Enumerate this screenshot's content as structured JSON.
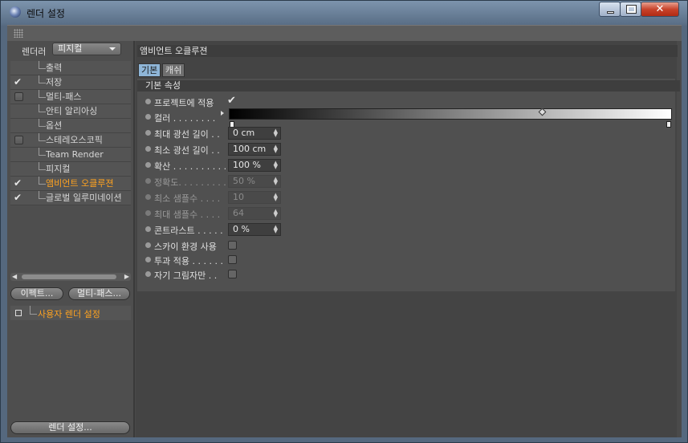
{
  "window": {
    "title": "렌더 설정"
  },
  "left": {
    "renderer_label": "렌더러",
    "renderer_value": "피지컬",
    "items": [
      {
        "label": "출력",
        "check": "none",
        "active": false
      },
      {
        "label": "저장",
        "check": "tick",
        "active": false
      },
      {
        "label": "멀티-패스",
        "check": "box",
        "active": false
      },
      {
        "label": "안티 알리아싱",
        "check": "none",
        "active": false
      },
      {
        "label": "옵션",
        "check": "none",
        "active": false
      },
      {
        "label": "스테레오스코픽",
        "check": "box",
        "active": false
      },
      {
        "label": "Team Render",
        "check": "none",
        "active": false
      },
      {
        "label": "피지컬",
        "check": "none",
        "active": false
      },
      {
        "label": "앰비언트 오클루젼",
        "check": "tick",
        "active": true
      },
      {
        "label": "글로벌 일루미네이션",
        "check": "tick",
        "active": false
      }
    ],
    "effect_button": "이펙트...",
    "multipass_button": "멀티-패스...",
    "user_setting": "사용자 렌더 설정",
    "render_settings_button": "렌더 설정..."
  },
  "right": {
    "section_title": "앰비언트 오클루젼",
    "tabs": [
      "기본",
      "캐쉬"
    ],
    "group_title": "기본 속성",
    "apply_to_project": "프로젝트에 적용",
    "color_label": "컬러 . . . . . . . .",
    "params": [
      {
        "label": "최대 광선 길이 . .",
        "value": "0 cm",
        "dim": false
      },
      {
        "label": "최소 광선 길이 . .",
        "value": "100 cm",
        "dim": false
      },
      {
        "label": "확산 . . . . . . . . . . .",
        "value": "100 %",
        "dim": false
      },
      {
        "label": "정확도. . . . . . . . .",
        "value": "50 %",
        "dim": true
      },
      {
        "label": "최소 샘플수 . . . .",
        "value": "10",
        "dim": true
      },
      {
        "label": "최대 샘플수 . . . .",
        "value": "64",
        "dim": true
      },
      {
        "label": "콘트라스트 . . . . .",
        "value": "0 %",
        "dim": false
      }
    ],
    "checks": [
      "스카이 환경 사용",
      "투과 적용 . . . . . .",
      "자기 그림자만 . ."
    ]
  }
}
